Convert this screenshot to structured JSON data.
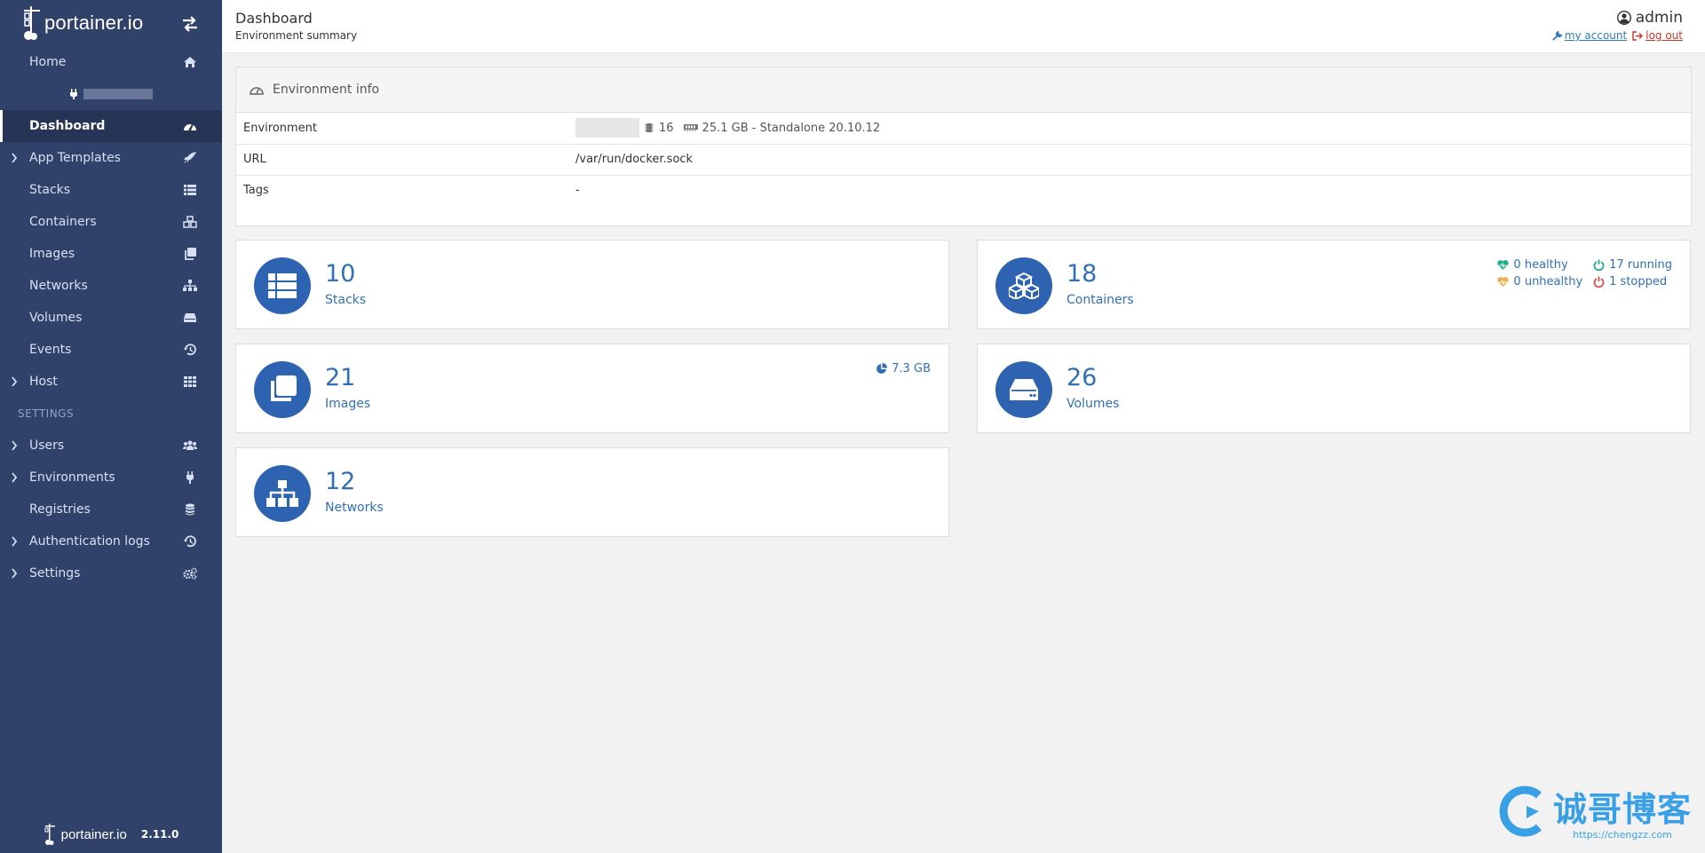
{
  "brand": {
    "name": "portainer.io",
    "version": "2.11.0"
  },
  "colors": {
    "sidebar_bg": "#30426a",
    "sidebar_active": "#263555",
    "accent_blue": "#2d63b0",
    "text_blue": "#3170b5",
    "healthy": "#23ae89",
    "unhealthy": "#f0ad4e",
    "stopped": "#d9534f"
  },
  "sidebar": {
    "items": [
      {
        "label": "Home",
        "icon": "home-icon"
      },
      {
        "label": "Dashboard",
        "icon": "dashboard-gauge-icon"
      },
      {
        "label": "App Templates",
        "icon": "rocket-icon"
      },
      {
        "label": "Stacks",
        "icon": "list-icon"
      },
      {
        "label": "Containers",
        "icon": "cubes-icon"
      },
      {
        "label": "Images",
        "icon": "clone-icon"
      },
      {
        "label": "Networks",
        "icon": "sitemap-icon"
      },
      {
        "label": "Volumes",
        "icon": "hdd-icon"
      },
      {
        "label": "Events",
        "icon": "history-icon"
      },
      {
        "label": "Host",
        "icon": "grid-icon"
      }
    ],
    "settings_heading": "SETTINGS",
    "settings_items": [
      {
        "label": "Users",
        "icon": "users-icon"
      },
      {
        "label": "Environments",
        "icon": "plug-icon"
      },
      {
        "label": "Registries",
        "icon": "database-icon"
      },
      {
        "label": "Authentication logs",
        "icon": "history-icon"
      },
      {
        "label": "Settings",
        "icon": "cogs-icon"
      }
    ]
  },
  "header": {
    "title": "Dashboard",
    "subtitle": "Environment summary",
    "user": "admin",
    "my_account": " my account ",
    "log_out": " log out"
  },
  "env_info": {
    "title": "Environment info",
    "rows": {
      "environment_label": "Environment",
      "cpu": "16",
      "memory": "25.1 GB - Standalone 20.10.12",
      "url_label": "URL",
      "url_value": "/var/run/docker.sock",
      "tags_label": "Tags",
      "tags_value": "-"
    }
  },
  "cards": {
    "stacks": {
      "count": "10",
      "label": "Stacks"
    },
    "containers": {
      "count": "18",
      "label": "Containers",
      "healthy": "0 healthy",
      "running": "17 running",
      "unhealthy": "0 unhealthy",
      "stopped": "1 stopped"
    },
    "images": {
      "count": "21",
      "label": "Images",
      "size": "7.3 GB"
    },
    "volumes": {
      "count": "26",
      "label": "Volumes"
    },
    "networks": {
      "count": "12",
      "label": "Networks"
    }
  },
  "watermark": {
    "title": "诚哥博客",
    "url": "https://chengzz.com"
  }
}
